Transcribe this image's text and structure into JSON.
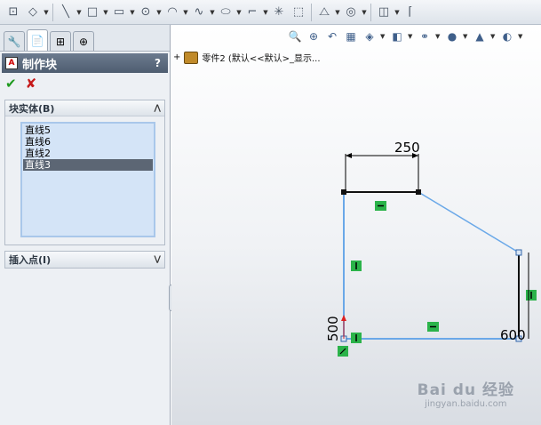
{
  "colors": {
    "accent": "#5c6674",
    "ok": "#1e9a1e",
    "cancel": "#c61a1a",
    "sketch_line": "#6aa8e8",
    "constraint": "#2bb34a"
  },
  "toolbar": {
    "icons": [
      "smart-dimension-icon",
      "sketch-icon",
      "line-icon",
      "rectangle-icon",
      "slot-icon",
      "circle-icon",
      "arc-icon",
      "spline-icon",
      "ellipse-icon",
      "fillet-icon",
      "point-icon",
      "construction-geometry-icon",
      "mirror-icon",
      "offset-icon",
      "convert-entities-icon",
      "trim-icon"
    ]
  },
  "panel": {
    "title": "制作块",
    "help": "?",
    "ok_glyph": "✔",
    "cancel_glyph": "✘",
    "block_group": {
      "label": "块实体(B)",
      "items": [
        "直线5",
        "直线6",
        "直线2",
        "直线3"
      ],
      "selected_index": 3
    },
    "insert_group": {
      "label": "插入点(I)"
    }
  },
  "canvas": {
    "tree_text": "零件2 (默认<<默认>_显示...",
    "dimensions": {
      "top": "250",
      "left": "500",
      "right": "600"
    }
  },
  "watermark": {
    "logo": "Bai du 经验",
    "url": "jingyan.baidu.com"
  }
}
